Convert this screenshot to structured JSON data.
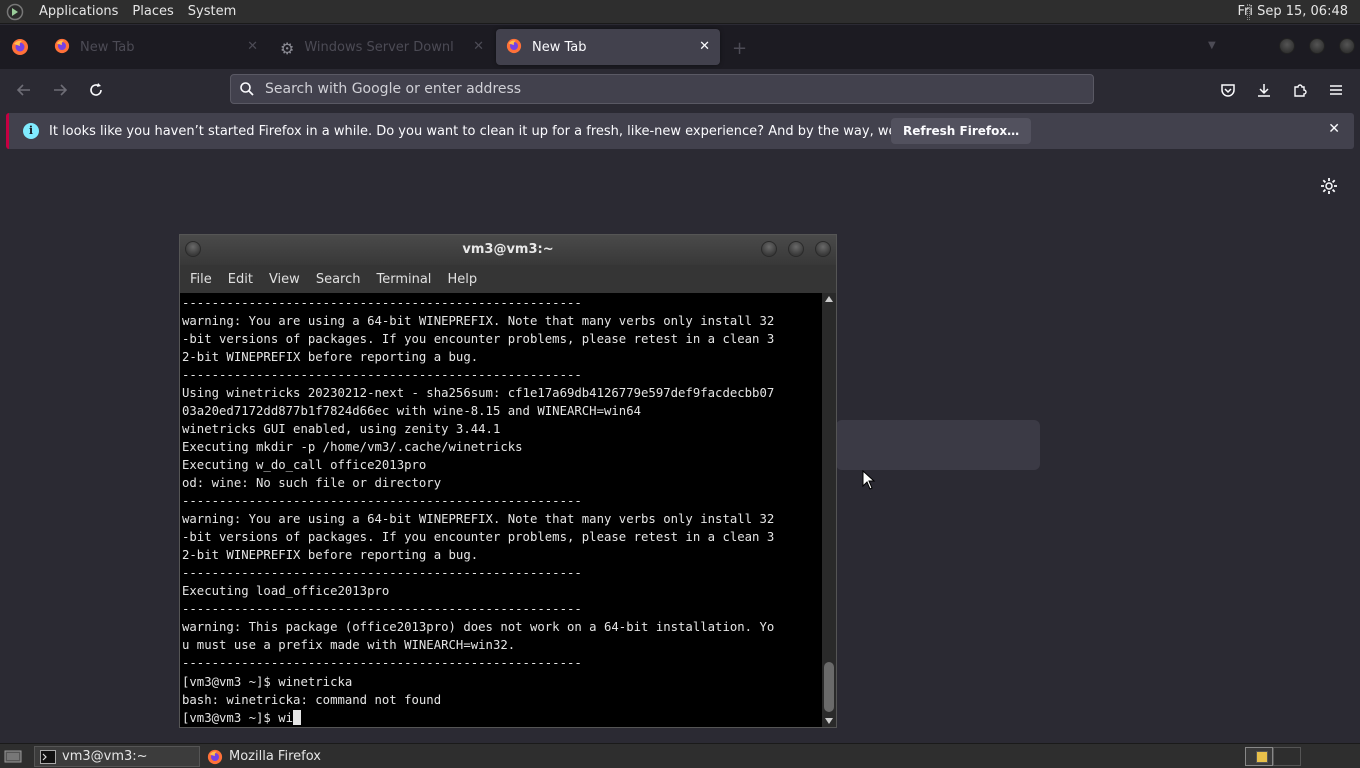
{
  "top_panel": {
    "menus": [
      "Applications",
      "Places",
      "System"
    ],
    "clock": "Fri Sep 15, 06:48"
  },
  "browser": {
    "tabs": [
      {
        "title": "New Tab",
        "state": "inactive"
      },
      {
        "title": "Windows Server Downloa",
        "state": "inactive"
      },
      {
        "title": "New Tab",
        "state": "active"
      }
    ],
    "url_placeholder": "Search with Google or enter address",
    "notification": {
      "message": "It looks like you haven’t started Firefox in a while. Do you want to clean it up for a fresh, like-new experience? And by the way, welcome back!",
      "button_label": "Refresh Firefox…"
    }
  },
  "terminal": {
    "title": "vm3@vm3:~",
    "menu": [
      "File",
      "Edit",
      "View",
      "Search",
      "Terminal",
      "Help"
    ],
    "lines": [
      "------------------------------------------------------",
      "warning: You are using a 64-bit WINEPREFIX. Note that many verbs only install 32",
      "-bit versions of packages. If you encounter problems, please retest in a clean 3",
      "2-bit WINEPREFIX before reporting a bug.",
      "------------------------------------------------------",
      "Using winetricks 20230212-next - sha256sum: cf1e17a69db4126779e597def9facdecbb07",
      "03a20ed7172dd877b1f7824d66ec with wine-8.15 and WINEARCH=win64",
      "winetricks GUI enabled, using zenity 3.44.1",
      "Executing mkdir -p /home/vm3/.cache/winetricks",
      "Executing w_do_call office2013pro",
      "od: wine: No such file or directory",
      "------------------------------------------------------",
      "warning: You are using a 64-bit WINEPREFIX. Note that many verbs only install 32",
      "-bit versions of packages. If you encounter problems, please retest in a clean 3",
      "2-bit WINEPREFIX before reporting a bug.",
      "------------------------------------------------------",
      "Executing load_office2013pro",
      "------------------------------------------------------",
      "warning: This package (office2013pro) does not work on a 64-bit installation. Yo",
      "u must use a prefix made with WINEARCH=win32.",
      "------------------------------------------------------",
      "[vm3@vm3 ~]$ winetricka",
      "bash: winetricka: command not found"
    ],
    "prompt_line": "[vm3@vm3 ~]$ wi"
  },
  "taskbar": {
    "tasks": [
      {
        "label": "vm3@vm3:~",
        "icon": "terminal-icon"
      },
      {
        "label": "Mozilla Firefox",
        "icon": "firefox-icon"
      }
    ]
  },
  "colors": {
    "browser_bg": "#2b2a33",
    "tabstrip_bg": "#1c1b22",
    "notice_accent": "#c50042",
    "info_icon": "#80ebff"
  }
}
